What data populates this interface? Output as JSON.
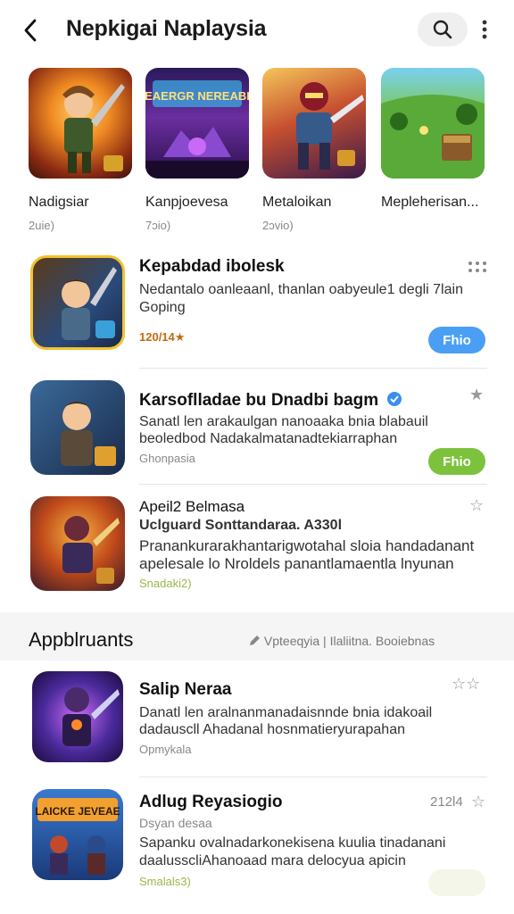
{
  "header": {
    "title": "Nepkigai Naplaysia",
    "back_icon": "chevron-left-icon",
    "search_icon": "search-icon",
    "more_icon": "more-vertical-icon"
  },
  "featured": [
    {
      "name": "Nadigsiar",
      "sub": "2uie)"
    },
    {
      "name": "Kanpjoevesa",
      "sub": "7ɔio)"
    },
    {
      "name": "Metaloikan",
      "sub": "2ɔvio)"
    },
    {
      "name": "Mepleherisan...",
      "sub": ""
    }
  ],
  "feature_banner_text": "EAERGR NEREABI",
  "apps": [
    {
      "title": "Kepabdad ibolesk",
      "line1": "Nedantalo oanleaanl, thanlan oabyeule1 degli 7lain",
      "line2": "Goping",
      "meta": "120/14★",
      "action": "Fhio",
      "action_color": "#4a9ff5"
    },
    {
      "title": "Karsoflladae bu Dnadbi bagm",
      "line1": "Sanatl len arakaulgan nanoaaka bnia blabauil",
      "line2": "beoledbod Nadakalmatanadtekiarraphan",
      "meta": "Ghonpasia",
      "action": "Fhio",
      "action_color": "#7cc23c"
    },
    {
      "title": "Apeil2 Belmasa",
      "subtitle": "Uclguard Sonttandaraa. A330l",
      "line1": "Pranankurarakhantarigwotahal sloia handadanant",
      "line2": "apelesale lo Nroldels panantlamaentla lnyunan",
      "meta": "Snadaki2)"
    }
  ],
  "section": {
    "title": "Appblruants",
    "links": "Vpteeqyia  |  Ilaliitna. Booiebnas"
  },
  "apps2": [
    {
      "title": "Salip Neraa",
      "line1": "Danatl len aralnanmanadaisnnde bnia idakoail",
      "line2": "dadauscll Ahadanal hosnmatieryurapahan",
      "meta": "Opmykala"
    },
    {
      "title": "Adlug Reyasiogio",
      "subtitle": "Dsyan desaa",
      "line1": "Sapanku ovalnadarkonekisena kuulia tinadanani",
      "line2": "daalusscliAhanoaad mara delocyua apicin",
      "meta": "Smalals3)",
      "rating": "212l4"
    }
  ],
  "icon_badge_text": "LAICKE JEVEAE"
}
